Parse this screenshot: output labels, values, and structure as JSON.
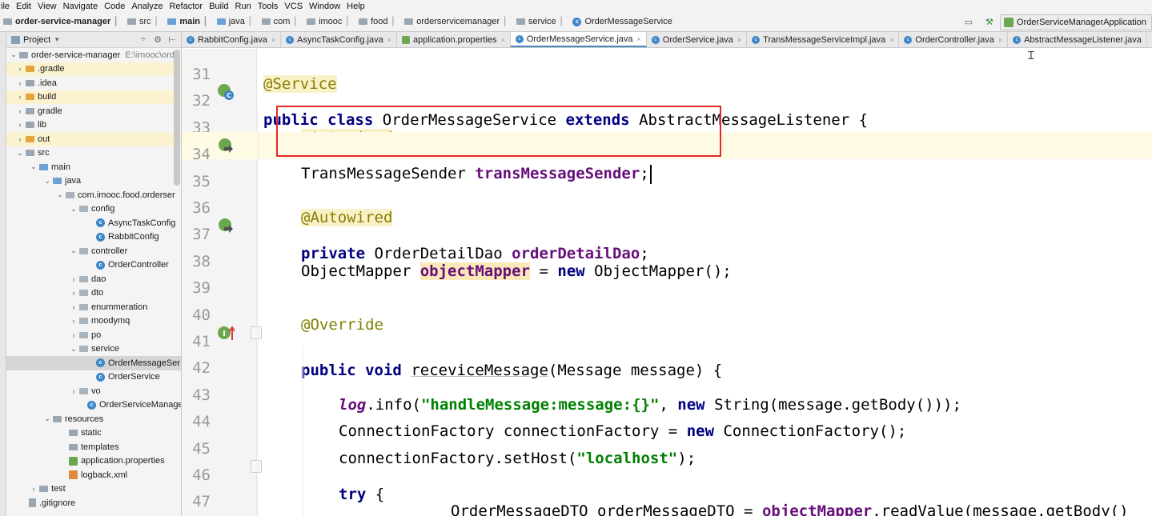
{
  "menu": {
    "items": [
      "ile",
      "Edit",
      "View",
      "Navigate",
      "Code",
      "Analyze",
      "Refactor",
      "Build",
      "Run",
      "Tools",
      "VCS",
      "Window",
      "Help"
    ]
  },
  "breadcrumb": {
    "items": [
      "order-service-manager",
      "src",
      "main",
      "java",
      "com",
      "imooc",
      "food",
      "orderservicemanager",
      "service",
      "OrderMessageService"
    ]
  },
  "toolbar": {
    "run_config": "OrderServiceManagerApplication"
  },
  "project_panel": {
    "title": "Project",
    "tree": [
      {
        "label": "order-service-manager",
        "extra": "E:\\imooc\\orde"
      },
      {
        "label": ".gradle"
      },
      {
        "label": ".idea"
      },
      {
        "label": "build"
      },
      {
        "label": "gradle"
      },
      {
        "label": "lib"
      },
      {
        "label": "out"
      },
      {
        "label": "src"
      },
      {
        "label": "main"
      },
      {
        "label": "java"
      },
      {
        "label": "com.imooc.food.orderser"
      },
      {
        "label": "config"
      },
      {
        "label": "AsyncTaskConfig"
      },
      {
        "label": "RabbitConfig"
      },
      {
        "label": "controller"
      },
      {
        "label": "OrderController"
      },
      {
        "label": "dao"
      },
      {
        "label": "dto"
      },
      {
        "label": "enummeration"
      },
      {
        "label": "moodymq"
      },
      {
        "label": "po"
      },
      {
        "label": "service"
      },
      {
        "label": "OrderMessageSer"
      },
      {
        "label": "OrderService"
      },
      {
        "label": "vo"
      },
      {
        "label": "OrderServiceManager"
      },
      {
        "label": "resources"
      },
      {
        "label": "static"
      },
      {
        "label": "templates"
      },
      {
        "label": "application.properties"
      },
      {
        "label": "logback.xml"
      },
      {
        "label": "test"
      },
      {
        "label": ".gitignore"
      }
    ]
  },
  "tabs": [
    {
      "label": "RabbitConfig.java"
    },
    {
      "label": "AsyncTaskConfig.java"
    },
    {
      "label": "application.properties"
    },
    {
      "label": "OrderMessageService.java"
    },
    {
      "label": "OrderService.java"
    },
    {
      "label": "TransMessageServiceImpl.java"
    },
    {
      "label": "OrderController.java"
    },
    {
      "label": "AbstractMessageListener.java"
    }
  ],
  "editor": {
    "line_numbers": [
      "31",
      "32",
      "33",
      "34",
      "35",
      "36",
      "37",
      "38",
      "39",
      "40",
      "41",
      "42",
      "43",
      "44",
      "45",
      "46",
      "47"
    ],
    "gutter_marks": {
      "l32": "C",
      "l41": "I"
    },
    "tokens": {
      "l31_ann": "@Service",
      "l32_kw1": "public",
      "l32_kw2": "class",
      "l32_name": "OrderMessageService",
      "l32_kw3": "extends",
      "l32_super": "AbstractMessageListener",
      "l32_brace": "{",
      "l33_ann": "@Autowired",
      "l34_type": "TransMessageSender",
      "l34_field": "transMessageSender",
      "l34_semi": ";",
      "l36_ann": "@Autowired",
      "l37_kw": "private",
      "l37_type": "OrderDetailDao",
      "l37_field": "orderDetailDao",
      "l37_semi": ";",
      "l38_type": "ObjectMapper",
      "l38_field": "objectMapper",
      "l38_eq": "=",
      "l38_kw": "new",
      "l38_rest": "ObjectMapper();",
      "l40_ann": "@Override",
      "l41_kw1": "public",
      "l41_kw2": "void",
      "l41_method": "receviceMessage",
      "l41_rest": "(Message message) {",
      "l43_log": "log",
      "l43_call": ".info(",
      "l43_str": "\"handleMessage:message:{}\"",
      "l43_comma": ",",
      "l43_kw": "new",
      "l43_rest": "String(message.getBody()));",
      "l44_a": "ConnectionFactory connectionFactory =",
      "l44_kw": "new",
      "l44_b": "ConnectionFactory();",
      "l45_a": "connectionFactory.setHost(",
      "l45_str": "\"localhost\"",
      "l45_b": ");",
      "l46_kw": "try",
      "l46_b": "{",
      "l47_a": "OrderMessageDTO orderMessageDTO =",
      "l47_field": "objectMapper",
      "l47_b": ".readValue(message.getBody()"
    }
  }
}
